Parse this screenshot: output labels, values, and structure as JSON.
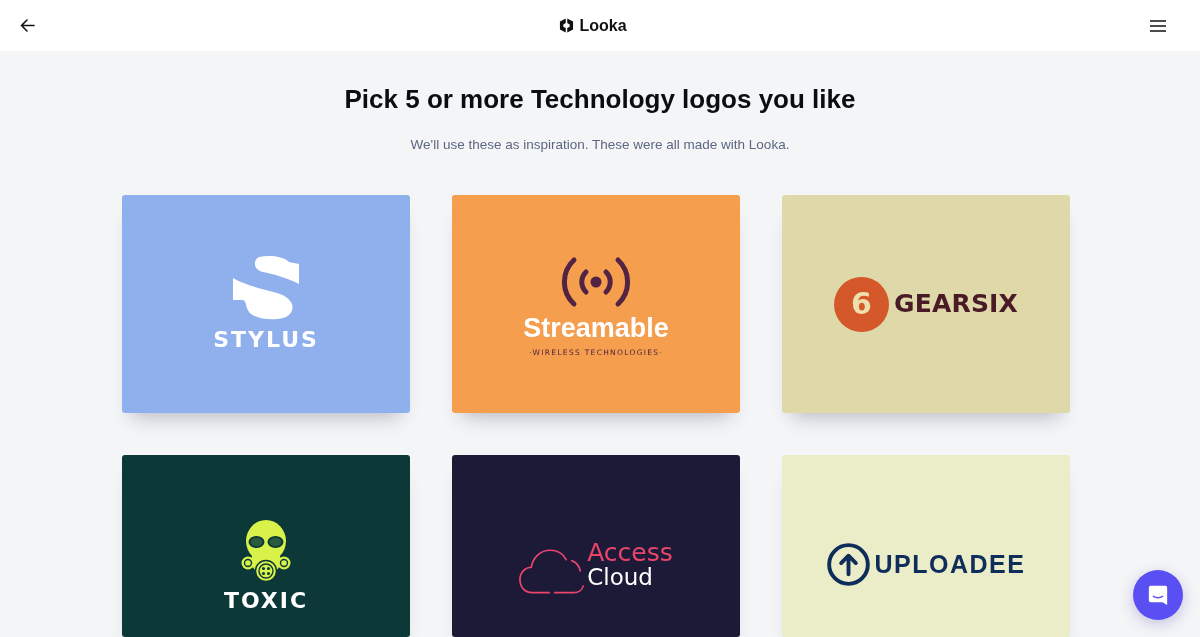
{
  "header": {
    "brand": "Looka"
  },
  "heading": "Pick 5 or more Technology logos you like",
  "subheading": "We'll use these as inspiration. These were all made with Looka.",
  "logo_cards": [
    {
      "color": "#8fb0ed",
      "name": "STYLUS"
    },
    {
      "color": "#f59e4e",
      "name": "Streamable",
      "tagline": "·WIRELESS TECHNOLOGIES·"
    },
    {
      "color": "#dfd9a9",
      "badge": "6",
      "name": "GEARSIX"
    },
    {
      "color": "#0c3838",
      "name": "TOXIC"
    },
    {
      "color": "#1d1a38",
      "name": "Access",
      "name_2": "Cloud"
    },
    {
      "color": "#eaedc7",
      "name": "UPLOADEE"
    }
  ]
}
